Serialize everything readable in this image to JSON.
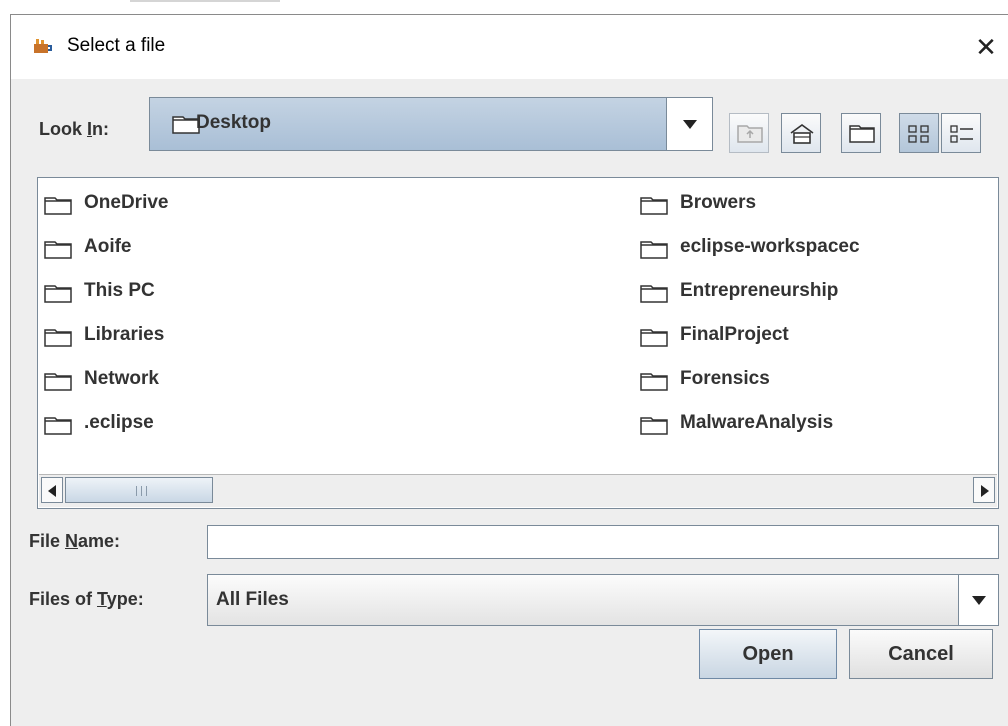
{
  "dialog": {
    "title": "Select a file",
    "close_glyph": "✕"
  },
  "look_in": {
    "label_pre": "Look ",
    "label_mnemonic": "I",
    "label_post": "n:",
    "value": "Desktop"
  },
  "toolbar": {
    "buttons": [
      {
        "name": "up-one-level",
        "icon": "up-folder-icon",
        "enabled": false
      },
      {
        "name": "home",
        "icon": "home-icon",
        "enabled": true
      },
      {
        "name": "create-new-folder",
        "icon": "new-folder-icon",
        "enabled": true
      },
      {
        "name": "list-view",
        "icon": "list-view-icon",
        "enabled": true,
        "selected": true
      },
      {
        "name": "details-view",
        "icon": "details-view-icon",
        "enabled": true
      }
    ]
  },
  "files": {
    "column1": [
      "OneDrive",
      "Aoife",
      "This PC",
      "Libraries",
      "Network",
      ".eclipse"
    ],
    "column2": [
      "Browers",
      "eclipse-workspacec",
      "Entrepreneurship",
      "FinalProject",
      "Forensics",
      "MalwareAnalysis"
    ]
  },
  "file_name": {
    "label_pre": "File ",
    "label_mnemonic": "N",
    "label_post": "ame:",
    "value": ""
  },
  "files_of_type": {
    "label_pre": "Files of ",
    "label_mnemonic": "T",
    "label_post": "ype:",
    "value": "All Files"
  },
  "buttons": {
    "open": "Open",
    "cancel": "Cancel"
  },
  "colors": {
    "accent": "#b3c6d9",
    "dialog_bg": "#eeeeee",
    "border": "#7a8a99"
  }
}
